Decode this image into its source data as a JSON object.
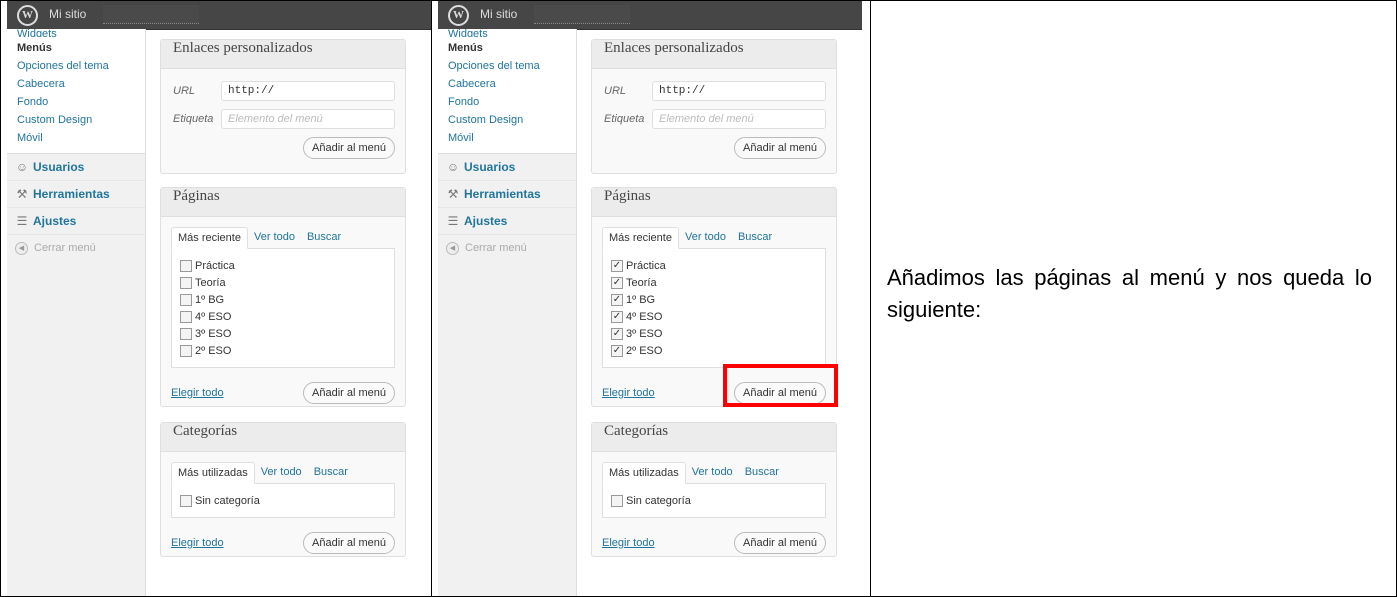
{
  "caption": "Añadimos las páginas al menú y nos queda lo siguiente:",
  "adminbar": {
    "site_name": "Mi sitio"
  },
  "sidebar": {
    "cut_item": "Widgets",
    "sub_items": [
      "Menús",
      "Opciones del tema",
      "Cabecera",
      "Fondo",
      "Custom Design",
      "Móvil"
    ],
    "current": "Menús",
    "menu": [
      {
        "label": "Usuarios",
        "icon": "users-icon"
      },
      {
        "label": "Herramientas",
        "icon": "tools-icon"
      },
      {
        "label": "Ajustes",
        "icon": "settings-icon"
      }
    ],
    "collapse_label": "Cerrar menú"
  },
  "links_panel": {
    "title": "Enlaces personalizados",
    "url_label": "URL",
    "url_value": "http://",
    "label_label": "Etiqueta",
    "label_placeholder": "Elemento del menú",
    "button": "Añadir al menú"
  },
  "pages_panel": {
    "title": "Páginas",
    "tabs": [
      "Más reciente",
      "Ver todo",
      "Buscar"
    ],
    "pages": [
      "Práctica",
      "Teoría",
      "1º BG",
      "4º ESO",
      "3º ESO",
      "2º ESO"
    ],
    "select_all": "Elegir todo",
    "button": "Añadir al menú"
  },
  "categories_panel": {
    "title": "Categorías",
    "tabs": [
      "Más utilizadas",
      "Ver todo",
      "Buscar"
    ],
    "items": [
      "Sin categoría"
    ],
    "select_all": "Elegir todo",
    "button": "Añadir al menú"
  },
  "screenshots": [
    {
      "pages_checked": [
        false,
        false,
        false,
        false,
        false,
        false
      ]
    },
    {
      "pages_checked": [
        true,
        true,
        true,
        true,
        true,
        true
      ]
    }
  ],
  "colors": {
    "link": "#21759b",
    "highlight": "#ff0000",
    "adminbar": "#464646"
  }
}
